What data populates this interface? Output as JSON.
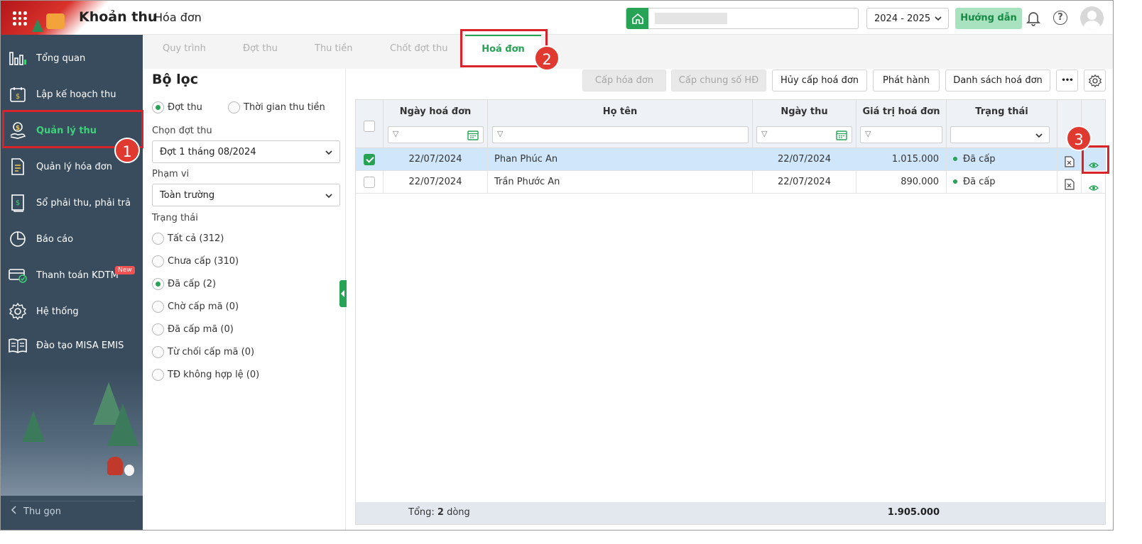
{
  "header": {
    "app_title": "Khoản thu",
    "page_title": "Hóa đơn",
    "school_year": "2024 - 2025",
    "guide_label": "Hướng dẫn"
  },
  "sidebar": {
    "items": [
      {
        "label": "Tổng quan",
        "icon": "chart-bars-icon"
      },
      {
        "label": "Lập kế hoạch thu",
        "icon": "calendar-dollar-icon"
      },
      {
        "label": "Quản lý thu",
        "icon": "hand-coin-icon"
      },
      {
        "label": "Quản lý hóa đơn",
        "icon": "document-icon"
      },
      {
        "label": "Sổ phải thu, phải trả",
        "icon": "ledger-icon"
      },
      {
        "label": "Báo cáo",
        "icon": "pie-chart-icon"
      },
      {
        "label": "Thanh toán KDTM",
        "icon": "card-check-icon",
        "badge": "New"
      },
      {
        "label": "Hệ thống",
        "icon": "gear-icon"
      },
      {
        "label": "Đào tạo MISA EMIS",
        "icon": "open-book-icon"
      }
    ],
    "collapse_label": "Thu gọn"
  },
  "tabs": [
    "Quy trình",
    "Đợt thu",
    "Thu tiền",
    "Chốt đợt thu",
    "Hoá đơn"
  ],
  "filter": {
    "title": "Bộ lọc",
    "mode_options": [
      "Đợt thu",
      "Thời gian thu tiền"
    ],
    "batch_label": "Chọn đợt thu",
    "batch_value": "Đợt 1 tháng 08/2024",
    "scope_label": "Phạm vi",
    "scope_value": "Toàn trường",
    "status_label": "Trạng thái",
    "status_options": [
      "Tất cả (312)",
      "Chưa cấp (310)",
      "Đã cấp (2)",
      "Chờ cấp mã (0)",
      "Đã cấp mã (0)",
      "Từ chối cấp mã (0)",
      "TĐ không hợp lệ (0)"
    ],
    "status_selected": "Đã cấp (2)"
  },
  "toolbar": {
    "issue_invoice": "Cấp hóa đơn",
    "issue_common_number": "Cấp chung số HĐ",
    "cancel_issue": "Hủy cấp hoá đơn",
    "publish": "Phát hành",
    "invoice_list": "Danh sách hoá đơn",
    "more": "•••"
  },
  "table": {
    "columns": [
      "Ngày hoá đơn",
      "Họ tên",
      "Ngày thu",
      "Giá trị hoá đơn",
      "Trạng thái"
    ],
    "rows": [
      {
        "invoice_date": "22/07/2024",
        "name": "Phan Phúc An",
        "collect_date": "22/07/2024",
        "amount": "1.015.000",
        "status": "Đã cấp",
        "checked": true
      },
      {
        "invoice_date": "22/07/2024",
        "name": "Trần Phước An",
        "collect_date": "22/07/2024",
        "amount": "890.000",
        "status": "Đã cấp",
        "checked": false
      }
    ],
    "footer_prefix": "Tổng:",
    "footer_count": "2",
    "footer_suffix": "dòng",
    "footer_total": "1.905.000"
  },
  "annotations": [
    "1",
    "2",
    "3"
  ],
  "colors": {
    "accent": "#27a356",
    "sidebar": "#394c5e",
    "annotation": "#d8232a",
    "selected_row": "#cfe6fb"
  }
}
